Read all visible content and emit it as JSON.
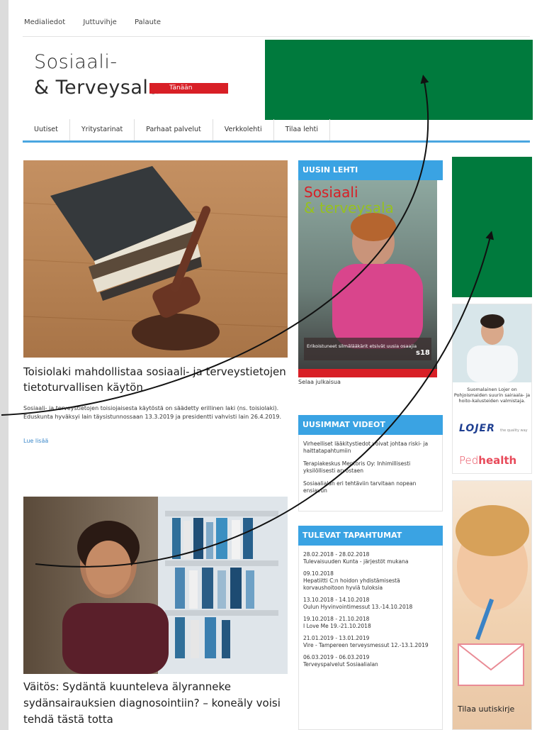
{
  "toplinks": [
    "Medialiedot",
    "Juttuvihje",
    "Palaute"
  ],
  "logo": {
    "line1": "Sosiaali-",
    "line2": "& Terveysala",
    "tag": "Tänään"
  },
  "nav": [
    "Uutiset",
    "Yritystarinat",
    "Parhaat palvelut",
    "Verkkolehti",
    "Tilaa lehti"
  ],
  "articles": [
    {
      "title": "Toisiolaki mahdollistaa sosiaali- ja terveystietojen tietoturvallisen käytön",
      "excerpt": "Sosiaali- ja terveystietojen toisiojaisesta käytöstä on säädetty erillinen laki (ns. toisiolaki). Eduskunta hyväksyi lain täysistunnossaan 13.3.2019 ja presidentti vahvisti lain 26.4.2019.",
      "more": "Lue lisää"
    },
    {
      "title": "Väitös: Sydäntä kuunteleva älyranneke sydänsairauksien diagnosointiin? – koneäly voisi tehdä tästä totta"
    }
  ],
  "sidebar": {
    "latest_issue": {
      "heading": "UUSIN LEHTI",
      "caption": "Selaa julkaisua",
      "cover_title1": "Sosiaali",
      "cover_title2": "& terveysala",
      "cover_headline": "Erikoistuneet silmälääkärit etsivät uusia osaajia",
      "cover_badge": "s18"
    },
    "videos": {
      "heading": "UUSIMMAT VIDEOT",
      "items": [
        "Virheelliset lääkitystiedot voivat johtaa riski- ja haittatapahtumiin",
        "Terapiakeskus Mentoris Oy: Inhimillisesti yksilöllisesti arvostaen",
        "Sosiaalialan eri tehtäviin tarvitaan nopean ensiavun"
      ]
    },
    "events": {
      "heading": "TULEVAT TAPAHTUMAT",
      "items": [
        {
          "date": "28.02.2018 - 28.02.2018",
          "text": "Tulevaisuuden Kunta - järjestöt mukana"
        },
        {
          "date": "09.10.2018",
          "text": "Hepatiitti C:n hoidon yhdistämisestä korvaushoitoon hyviä tuloksia"
        },
        {
          "date": "13.10.2018 - 14.10.2018",
          "text": "Oulun Hyvinvointimessut 13.-14.10.2018"
        },
        {
          "date": "19.10.2018 - 21.10.2018",
          "text": "I Love Me 19.-21.10.2018"
        },
        {
          "date": "21.01.2019 - 13.01.2019",
          "text": "Vire - Tampereen terveysmessut 12.-13.1.2019"
        },
        {
          "date": "06.03.2019 - 06.03.2019",
          "text": "Terveyspalvelut Sosiaalialan"
        }
      ]
    }
  },
  "ads": {
    "lojer_text": "Suomalainen Lojer on Pohjoismaiden suurin sairaala- ja hoito-kalusteiden valmistaja.",
    "lojer": "LOJER",
    "lojer_small": "the quality way",
    "ped": "Ped",
    "health": "health",
    "newsletter": "Tilaa uutiskirje"
  },
  "colors": {
    "accent_blue": "#3aa3e3",
    "ad_green": "#007a3d",
    "brand_red": "#d81f26"
  }
}
